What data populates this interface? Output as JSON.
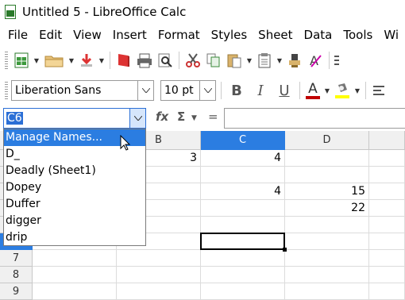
{
  "window": {
    "title": "Untitled 5 - LibreOffice Calc"
  },
  "menu": [
    "File",
    "Edit",
    "View",
    "Insert",
    "Format",
    "Styles",
    "Sheet",
    "Data",
    "Tools",
    "Wi"
  ],
  "toolbar": {
    "font_name": "Liberation Sans",
    "font_size": "10 pt",
    "bold": "B",
    "italic": "I",
    "underline": "U",
    "font_color_glyph": "A"
  },
  "formula_bar": {
    "name_box": "C6",
    "fx": "fx",
    "sigma": "Σ",
    "equals": "="
  },
  "name_dropdown": {
    "items": [
      "Manage Names...",
      "D_",
      "Deadly (Sheet1)",
      "Dopey",
      "Duffer",
      "digger",
      "drip"
    ],
    "highlighted": "Manage Names..."
  },
  "grid": {
    "columns": [
      "B",
      "C",
      "D"
    ],
    "selected_column": "C",
    "row_numbers": [
      "7",
      "8",
      "9"
    ],
    "cells": {
      "b1": "3",
      "c1": "4",
      "c3": "4",
      "d3": "15",
      "d4": "22"
    }
  },
  "colors": {
    "accent": "#2b7de1",
    "font_color": "#c00000",
    "highlight": "#ffff00"
  }
}
